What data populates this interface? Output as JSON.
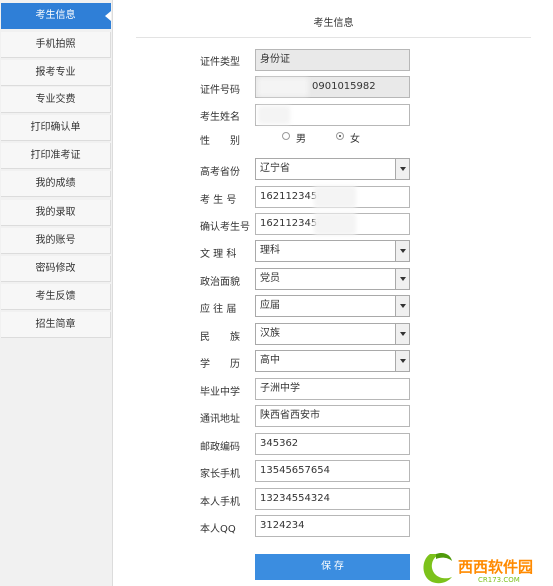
{
  "sidebar": {
    "items": [
      {
        "label": "考生信息",
        "active": true
      },
      {
        "label": "手机拍照"
      },
      {
        "label": "报考专业"
      },
      {
        "label": "专业交费"
      },
      {
        "label": "打印确认单"
      },
      {
        "label": "打印准考证"
      },
      {
        "label": "我的成绩"
      },
      {
        "label": "我的录取"
      },
      {
        "label": "我的账号"
      },
      {
        "label": "密码修改"
      },
      {
        "label": "考生反馈"
      },
      {
        "label": "招生简章"
      }
    ]
  },
  "form": {
    "title": "考生信息",
    "id_type": {
      "label": "证件类型",
      "value": "身份证"
    },
    "id_number": {
      "label": "证件号码",
      "value": "0901015982"
    },
    "name": {
      "label": "考生姓名",
      "value": ""
    },
    "gender": {
      "label": "性　　别",
      "options": [
        "男",
        "女"
      ],
      "selected": "女"
    },
    "province": {
      "label": "高考省份",
      "value": "辽宁省"
    },
    "exam_number": {
      "label": "考 生 号",
      "value": "1621123456"
    },
    "confirm_exam_number": {
      "label": "确认考生号",
      "value": "1621123456"
    },
    "subject_type": {
      "label": "文 理 科",
      "value": "理科"
    },
    "political_status": {
      "label": "政治面貌",
      "value": "党员"
    },
    "graduate_type": {
      "label": "应 往 届",
      "value": "应届"
    },
    "ethnicity": {
      "label": "民　　族",
      "value": "汉族"
    },
    "education": {
      "label": "学　　历",
      "value": "高中"
    },
    "high_school": {
      "label": "毕业中学",
      "value": "子洲中学"
    },
    "address": {
      "label": "通讯地址",
      "value": "陕西省西安市"
    },
    "postal_code": {
      "label": "邮政编码",
      "value": "345362"
    },
    "parent_phone": {
      "label": "家长手机",
      "value": "13545657654"
    },
    "own_phone": {
      "label": "本人手机",
      "value": "13234554324"
    },
    "qq": {
      "label": "本人QQ",
      "value": "3124234"
    },
    "save_label": "保 存"
  },
  "watermark": {
    "brand": "西西软件园",
    "domain": "CR173.COM"
  },
  "colors": {
    "accent": "#2f7fd7",
    "button": "#3b8de0",
    "sidebar_bg": "#f1f1f1",
    "readonly_bg": "#e9e9e9"
  }
}
